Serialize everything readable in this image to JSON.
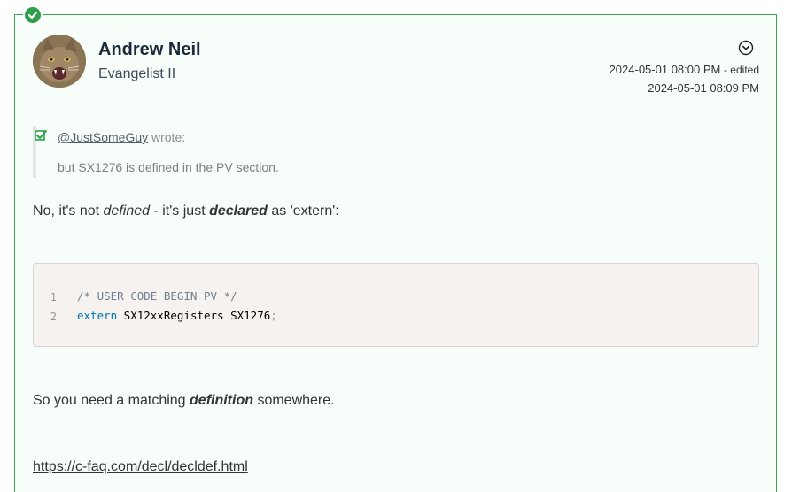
{
  "post": {
    "author": {
      "name": "Andrew Neil",
      "rank": "Evangelist II"
    },
    "timestamps": {
      "posted": "2024-05-01 08:00 PM",
      "edited_label": "- edited",
      "edited": "2024-05-01 08:09 PM"
    },
    "quote": {
      "user": "@JustSomeGuy",
      "wrote": "wrote:",
      "text": "but SX1276 is defined in the PV section."
    },
    "paragraph1": {
      "part1": "No, it's not ",
      "em1": "defined",
      "part2": " - it's just ",
      "em2": "declared",
      "part3": " as 'extern':"
    },
    "code": {
      "line_numbers": [
        "1",
        "2"
      ],
      "line1_comment": "/* USER CODE BEGIN PV */",
      "line2_keyword": "extern",
      "line2_rest": " SX12xxRegisters SX1276",
      "line2_punct": ";"
    },
    "paragraph2": {
      "part1": "So you need a matching ",
      "em1": "definition",
      "part2": " somewhere."
    },
    "link": "https://c-faq.com/decl/decldef.html"
  },
  "colors": {
    "accent_green": "#2e9e4a",
    "border_green": "#3aa655",
    "post_background": "#f7fdf9",
    "code_background": "#f5f2f0"
  },
  "icons": [
    "solved-check-icon",
    "chevron-down-icon",
    "quote-check-icon"
  ]
}
